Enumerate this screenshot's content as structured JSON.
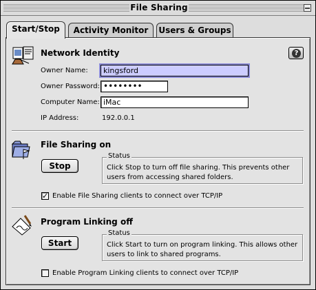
{
  "window": {
    "title": "File Sharing"
  },
  "tabs": [
    {
      "label": "Start/Stop",
      "active": true
    },
    {
      "label": "Activity Monitor",
      "active": false
    },
    {
      "label": "Users & Groups",
      "active": false
    }
  ],
  "network_identity": {
    "title": "Network Identity",
    "owner_name_label": "Owner Name:",
    "owner_name_value": "kingsford",
    "owner_password_label": "Owner Password:",
    "owner_password_value": "••••••••",
    "computer_name_label": "Computer Name:",
    "computer_name_value": "iMac",
    "ip_address_label": "IP Address:",
    "ip_address_value": "192.0.0.1",
    "help_glyph": "?"
  },
  "file_sharing": {
    "title": "File Sharing on",
    "button_label": "Stop",
    "status_legend": "Status",
    "status_text": "Click Stop to turn off file sharing. This prevents other users from accessing shared folders.",
    "checkbox_label": "Enable File Sharing clients to connect over TCP/IP",
    "checkbox_checked": true,
    "checkbox_mark": "✓"
  },
  "program_linking": {
    "title": "Program Linking off",
    "button_label": "Start",
    "status_legend": "Status",
    "status_text": "Click Start to turn on program linking. This allows other users to link to shared programs.",
    "checkbox_label": "Enable Program Linking clients to connect over TCP/IP",
    "checkbox_checked": false
  },
  "icons": {
    "network": "network-identity-icon",
    "folder": "shared-folder-icon",
    "linking": "program-linking-icon",
    "help": "help-icon",
    "close": "close-box-icon",
    "collapse": "collapse-box-icon"
  }
}
